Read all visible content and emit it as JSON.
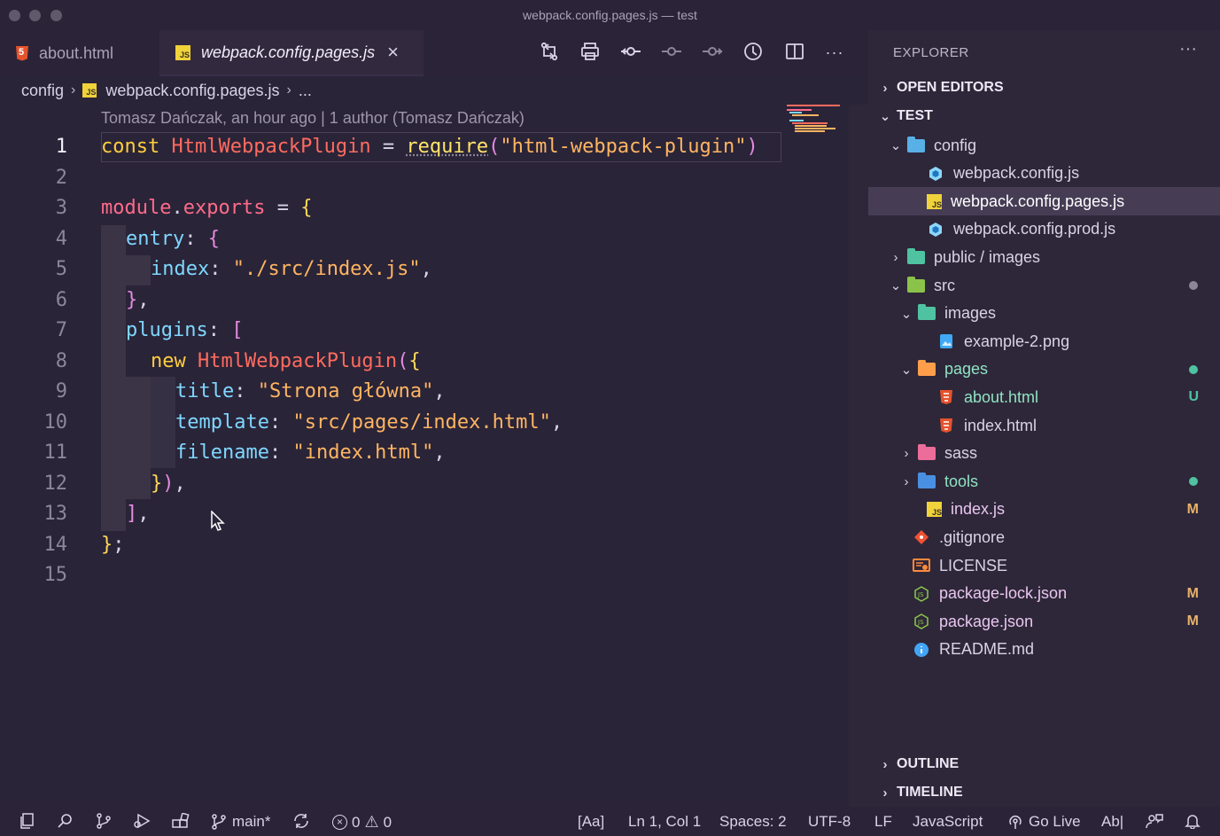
{
  "window": {
    "title": "webpack.config.pages.js — test"
  },
  "tabs": [
    {
      "label": "about.html",
      "icon": "html5-icon",
      "active": false
    },
    {
      "label": "webpack.config.pages.js",
      "icon": "js-icon",
      "active": true,
      "close": "×"
    }
  ],
  "toolbar": [
    {
      "name": "compare-changes-icon",
      "glyph": "⇅"
    },
    {
      "name": "print-icon",
      "glyph": "⎙"
    },
    {
      "name": "git-commit-icon",
      "glyph": "⊸"
    },
    {
      "name": "previous-change-icon",
      "glyph": "⊸"
    },
    {
      "name": "next-change-icon",
      "glyph": "⊸"
    },
    {
      "name": "timeline-icon",
      "glyph": "◷"
    },
    {
      "name": "split-editor-icon",
      "glyph": "◫"
    },
    {
      "name": "more-actions-icon",
      "glyph": "···"
    }
  ],
  "breadcrumb": {
    "folder": "config",
    "file": "webpack.config.pages.js",
    "more": "..."
  },
  "editor": {
    "blame": "Tomasz Dańczak, an hour ago | 1 author (Tomasz Dańczak)",
    "current_line": 1,
    "line_numbers": [
      "1",
      "2",
      "3",
      "4",
      "5",
      "6",
      "7",
      "8",
      "9",
      "10",
      "11",
      "12",
      "13",
      "14",
      "15"
    ],
    "code": {
      "l1": {
        "kw": "const",
        "name": "HtmlWebpackPlugin",
        "eq": " = ",
        "fn": "require",
        "open": "(",
        "str": "\"html-webpack-plugin\"",
        "close": ")"
      },
      "l3": {
        "obj": "module",
        "dot": ".",
        "prop": "exports",
        "eq": " = ",
        "brace": "{"
      },
      "l4": {
        "key": "entry",
        "colon": ": ",
        "brace": "{"
      },
      "l5": {
        "key": "index",
        "colon": ": ",
        "str": "\"./src/index.js\"",
        "comma": ","
      },
      "l6": {
        "brace": "}",
        "comma": ","
      },
      "l7": {
        "key": "plugins",
        "colon": ": ",
        "bracket": "["
      },
      "l8": {
        "kw": "new",
        "cls": "HtmlWebpackPlugin",
        "paren": "(",
        "brace": "{"
      },
      "l9": {
        "key": "title",
        "colon": ": ",
        "str": "\"Strona główna\"",
        "comma": ","
      },
      "l10": {
        "key": "template",
        "colon": ": ",
        "str": "\"src/pages/index.html\"",
        "comma": ","
      },
      "l11": {
        "key": "filename",
        "colon": ": ",
        "str": "\"index.html\"",
        "comma": ","
      },
      "l12": {
        "brace": "}",
        "paren": ")",
        "comma": ","
      },
      "l13": {
        "bracket": "]",
        "comma": ","
      },
      "l14": {
        "brace": "}",
        "semi": ";"
      }
    }
  },
  "explorer": {
    "title": "EXPLORER",
    "more": "···",
    "sections": {
      "open_editors": "OPEN EDITORS",
      "project": "TEST",
      "outline": "OUTLINE",
      "timeline": "TIMELINE"
    },
    "tree": [
      {
        "label": "config",
        "depth": 1,
        "type": "folder",
        "open": true,
        "color": "#59b0e6"
      },
      {
        "label": "webpack.config.js",
        "depth": 2,
        "type": "webpack"
      },
      {
        "label": "webpack.config.pages.js",
        "depth": 2,
        "type": "js",
        "selected": true
      },
      {
        "label": "webpack.config.prod.js",
        "depth": 2,
        "type": "webpack"
      },
      {
        "label": "public / images",
        "depth": 1,
        "type": "folder",
        "open": false,
        "color": "#4fc3a1"
      },
      {
        "label": "src",
        "depth": 1,
        "type": "folder",
        "open": true,
        "color": "#8bc34a",
        "dot": "#8c869a"
      },
      {
        "label": "images",
        "depth": 2,
        "type": "folder",
        "open": true,
        "color": "#4fc3a1"
      },
      {
        "label": "example-2.png",
        "depth": 3,
        "type": "image"
      },
      {
        "label": "pages",
        "depth": 2,
        "type": "folder",
        "open": true,
        "color": "#ff9e4a",
        "dot": "#4fc3a1",
        "accent": true
      },
      {
        "label": "about.html",
        "depth": 3,
        "type": "html",
        "badge": "U",
        "badge_color": "#4fc3a1",
        "accent": true
      },
      {
        "label": "index.html",
        "depth": 3,
        "type": "html"
      },
      {
        "label": "sass",
        "depth": 2,
        "type": "folder",
        "open": false,
        "color": "#ec6c9a"
      },
      {
        "label": "tools",
        "depth": 2,
        "type": "folder",
        "open": false,
        "color": "#4a90e2",
        "dot": "#4fc3a1",
        "accent": true
      },
      {
        "label": "index.js",
        "depth": 2,
        "type": "js",
        "badge": "M",
        "badge_color": "#e6b168",
        "modified": true
      },
      {
        "label": ".gitignore",
        "depth": 1,
        "type": "git"
      },
      {
        "label": "LICENSE",
        "depth": 1,
        "type": "license"
      },
      {
        "label": "package-lock.json",
        "depth": 1,
        "type": "node",
        "badge": "M",
        "badge_color": "#e6b168",
        "modified": true
      },
      {
        "label": "package.json",
        "depth": 1,
        "type": "node",
        "badge": "M",
        "badge_color": "#e6b168",
        "modified": true
      },
      {
        "label": "README.md",
        "depth": 1,
        "type": "info"
      }
    ]
  },
  "statusbar": {
    "branch": "main*",
    "errors": "0",
    "warnings": "0",
    "case": "[Aa]",
    "position": "Ln 1, Col 1",
    "spaces": "Spaces: 2",
    "encoding": "UTF-8",
    "eol": "LF",
    "language": "JavaScript",
    "live": "Go Live",
    "format": "Ab|"
  },
  "colors": {
    "accent_green": "#4fc3a1",
    "modified": "#e6b168",
    "selection": "#463d55"
  }
}
